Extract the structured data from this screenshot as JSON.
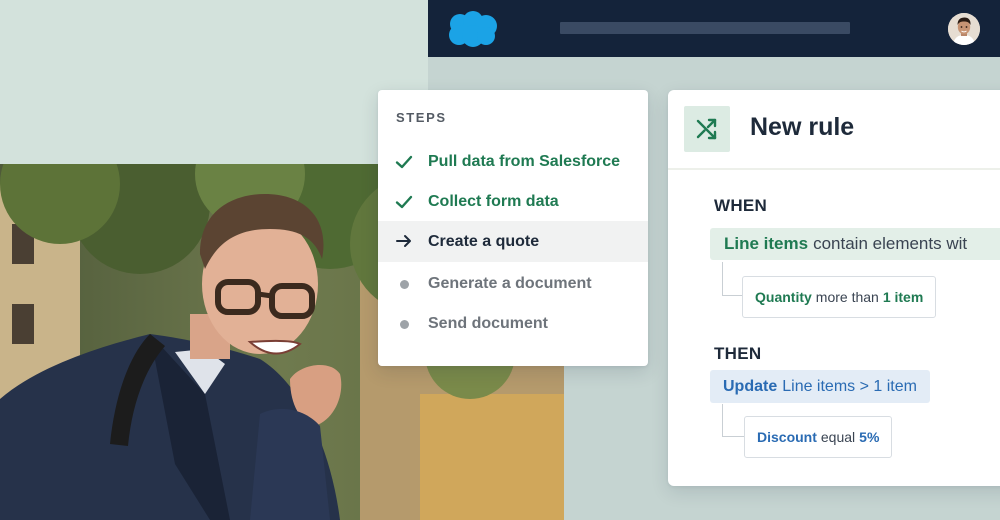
{
  "steps_panel": {
    "title": "STEPS",
    "items": [
      {
        "label": "Pull data from Salesforce",
        "status": "done",
        "icon": "check-icon"
      },
      {
        "label": "Collect form data",
        "status": "done",
        "icon": "check-icon"
      },
      {
        "label": "Create a quote",
        "status": "active",
        "icon": "arrow-right-icon"
      },
      {
        "label": "Generate a document",
        "status": "pending",
        "icon": "dot-icon"
      },
      {
        "label": "Send document",
        "status": "pending",
        "icon": "dot-icon"
      }
    ]
  },
  "rule_panel": {
    "icon": "shuffle-icon",
    "title": "New rule",
    "when": {
      "label": "WHEN",
      "condition_keyword": "Line items",
      "condition_text": "contain elements wit",
      "sub_keyword": "Quantity",
      "sub_operator": "more than",
      "sub_value": "1 item"
    },
    "then": {
      "label": "THEN",
      "action_keyword": "Update",
      "action_text": "Line items > 1 item",
      "sub_keyword": "Discount",
      "sub_operator": "equal",
      "sub_value": "5%"
    }
  },
  "colors": {
    "background_left": "#d3e2dc",
    "background_right": "#c5d4d1",
    "topbar": "#14233a",
    "brand_blue": "#1ba3e6",
    "done_green": "#1f7a52",
    "action_blue": "#2a6bb3"
  }
}
